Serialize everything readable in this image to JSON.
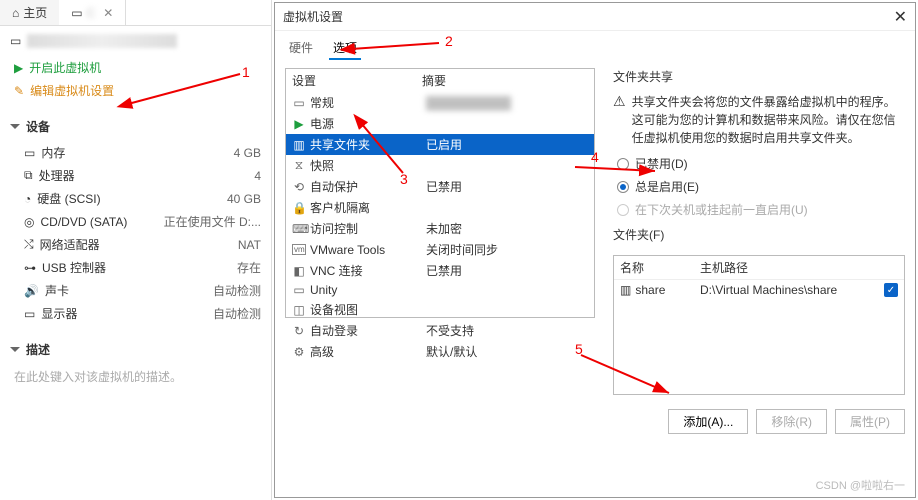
{
  "left": {
    "home_tab": "主页",
    "vm_tab_placeholder": "C",
    "action_start": "开启此虚拟机",
    "action_edit": "编辑虚拟机设置",
    "devices_header": "设备",
    "devices": [
      {
        "icon": "▭",
        "label": "内存",
        "value": "4 GB"
      },
      {
        "icon": "⧉",
        "label": "处理器",
        "value": "4"
      },
      {
        "icon": "◔",
        "label": "硬盘 (SCSI)",
        "value": "40 GB"
      },
      {
        "icon": "◎",
        "label": "CD/DVD (SATA)",
        "value": "正在使用文件 D:..."
      },
      {
        "icon": "⤭",
        "label": "网络适配器",
        "value": "NAT"
      },
      {
        "icon": "⊶",
        "label": "USB 控制器",
        "value": "存在"
      },
      {
        "icon": "🔊",
        "label": "声卡",
        "value": "自动检测"
      },
      {
        "icon": "▭",
        "label": "显示器",
        "value": "自动检测"
      }
    ],
    "desc_header": "描述",
    "desc_hint": "在此处键入对该虚拟机的描述。"
  },
  "dialog": {
    "title": "虚拟机设置",
    "tab_hw": "硬件",
    "tab_opts": "选项",
    "col_setting": "设置",
    "col_summary": "摘要",
    "rows": [
      {
        "icon": "▭",
        "name": "常规",
        "summary_blur": "██████████"
      },
      {
        "icon": "▶",
        "name": "电源",
        "summary": ""
      },
      {
        "icon": "▥",
        "name": "共享文件夹",
        "summary": "已启用",
        "selected": true
      },
      {
        "icon": "⧖",
        "name": "快照",
        "summary": ""
      },
      {
        "icon": "⟲",
        "name": "自动保护",
        "summary": "已禁用"
      },
      {
        "icon": "🔒",
        "name": "客户机隔离",
        "summary": ""
      },
      {
        "icon": "⌨",
        "name": "访问控制",
        "summary": "未加密"
      },
      {
        "icon": "vm",
        "name": "VMware Tools",
        "summary": "关闭时间同步"
      },
      {
        "icon": "◧",
        "name": "VNC 连接",
        "summary": "已禁用"
      },
      {
        "icon": "▭",
        "name": "Unity",
        "summary": ""
      },
      {
        "icon": "◫",
        "name": "设备视图",
        "summary": ""
      },
      {
        "icon": "↻",
        "name": "自动登录",
        "summary": "不受支持"
      },
      {
        "icon": "⚙",
        "name": "高级",
        "summary": "默认/默认"
      }
    ],
    "share": {
      "section_title": "文件夹共享",
      "warning": "共享文件夹会将您的文件暴露给虚拟机中的程序。这可能为您的计算机和数据带来风险。请仅在您信任虚拟机使用您的数据时启用共享文件夹。",
      "opt_disabled": "已禁用(D)",
      "opt_always": "总是启用(E)",
      "opt_until_off": "在下次关机或挂起前一直启用(U)",
      "folders_label": "文件夹(F)",
      "col_name": "名称",
      "col_path": "主机路径",
      "folder_name": "share",
      "folder_path": "D:\\Virtual Machines\\share",
      "btn_add": "添加(A)...",
      "btn_remove": "移除(R)",
      "btn_props": "属性(P)"
    }
  },
  "annotations": {
    "a1": "1",
    "a2": "2",
    "a3": "3",
    "a4": "4",
    "a5": "5"
  },
  "watermark": "CSDN @啦啦右一"
}
